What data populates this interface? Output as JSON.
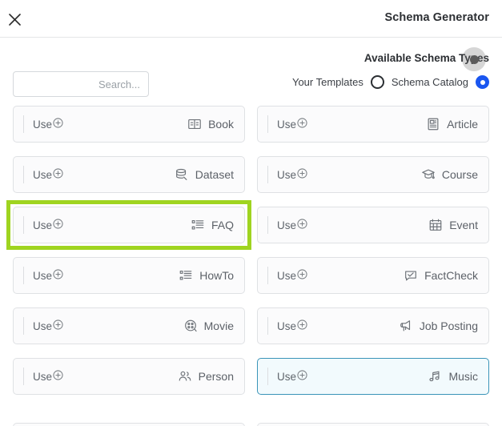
{
  "header": {
    "title": "Schema Generator",
    "close_icon": "close-icon"
  },
  "controls": {
    "section_title": "Available Schema Types",
    "search": {
      "placeholder": "...Search",
      "value": ""
    },
    "source_toggle": {
      "options": [
        {
          "label": "Your Templates",
          "selected": false
        },
        {
          "label": "Schema Catalog",
          "selected": true
        }
      ],
      "selected_color": "#1a56f0"
    }
  },
  "colors": {
    "highlight_ring": "#9fd420",
    "hover_border": "#3a94b8",
    "hover_background": "#f2fafd",
    "card_border": "#dfe1e4",
    "card_background": "#fbfbfc",
    "text": "#5c6168"
  },
  "cards": {
    "use_label": "Use",
    "plus_icon": "plus-circle-icon",
    "items": [
      {
        "label": "Book",
        "icon": "book-icon",
        "column": "left",
        "highlighted": false,
        "hovered": false
      },
      {
        "label": "Article",
        "icon": "article-icon",
        "column": "right",
        "highlighted": false,
        "hovered": false
      },
      {
        "label": "Dataset",
        "icon": "database-icon",
        "column": "left",
        "highlighted": false,
        "hovered": false
      },
      {
        "label": "Course",
        "icon": "graduation-cap-icon",
        "column": "right",
        "highlighted": false,
        "hovered": false
      },
      {
        "label": "FAQ",
        "icon": "list-bullet-icon",
        "column": "left",
        "highlighted": true,
        "hovered": false
      },
      {
        "label": "Event",
        "icon": "calendar-icon",
        "column": "right",
        "highlighted": false,
        "hovered": false
      },
      {
        "label": "HowTo",
        "icon": "list-bullet-icon",
        "column": "left",
        "highlighted": false,
        "hovered": false
      },
      {
        "label": "FactCheck",
        "icon": "check-bubble-icon",
        "column": "right",
        "highlighted": false,
        "hovered": false
      },
      {
        "label": "Movie",
        "icon": "film-reel-icon",
        "column": "left",
        "highlighted": false,
        "hovered": false
      },
      {
        "label": "Job Posting",
        "icon": "megaphone-icon",
        "column": "right",
        "highlighted": false,
        "hovered": false
      },
      {
        "label": "Person",
        "icon": "people-icon",
        "column": "left",
        "highlighted": false,
        "hovered": false
      },
      {
        "label": "Music",
        "icon": "music-note-icon",
        "column": "right",
        "highlighted": false,
        "hovered": true
      }
    ]
  },
  "cursor": {
    "name": "mouse-cursor-indicator"
  }
}
